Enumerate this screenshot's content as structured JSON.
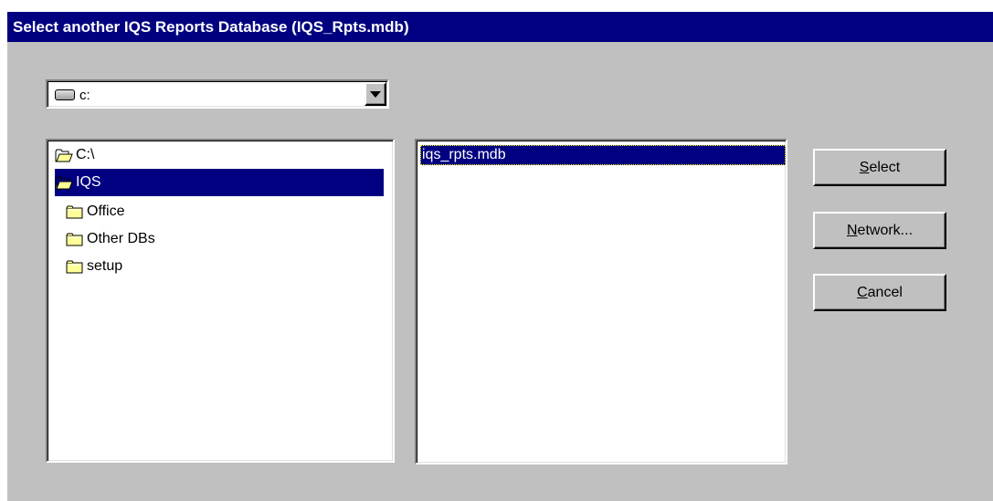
{
  "dialog": {
    "title": "Select another IQS Reports Database (IQS_Rpts.mdb)"
  },
  "drive_combo": {
    "icon": "hard-drive-icon",
    "value": "c:"
  },
  "directories": [
    {
      "label": "C:\\",
      "icon": "open-folder-icon",
      "selected": false
    },
    {
      "label": "IQS",
      "icon": "open-folder-icon",
      "selected": true
    },
    {
      "label": "Office",
      "icon": "folder-icon",
      "selected": false
    },
    {
      "label": "Other DBs",
      "icon": "folder-icon",
      "selected": false
    },
    {
      "label": "setup",
      "icon": "folder-icon",
      "selected": false
    }
  ],
  "files": [
    {
      "label": "iqs_rpts.mdb",
      "selected": true
    }
  ],
  "buttons": {
    "select": {
      "accel": "S",
      "rest": "elect"
    },
    "network": {
      "accel": "N",
      "rest": "etwork..."
    },
    "cancel": {
      "accel": "C",
      "rest": "ancel"
    }
  },
  "colors": {
    "titlebar": "#000080",
    "selection": "#000080",
    "face": "#c0c0c0"
  }
}
